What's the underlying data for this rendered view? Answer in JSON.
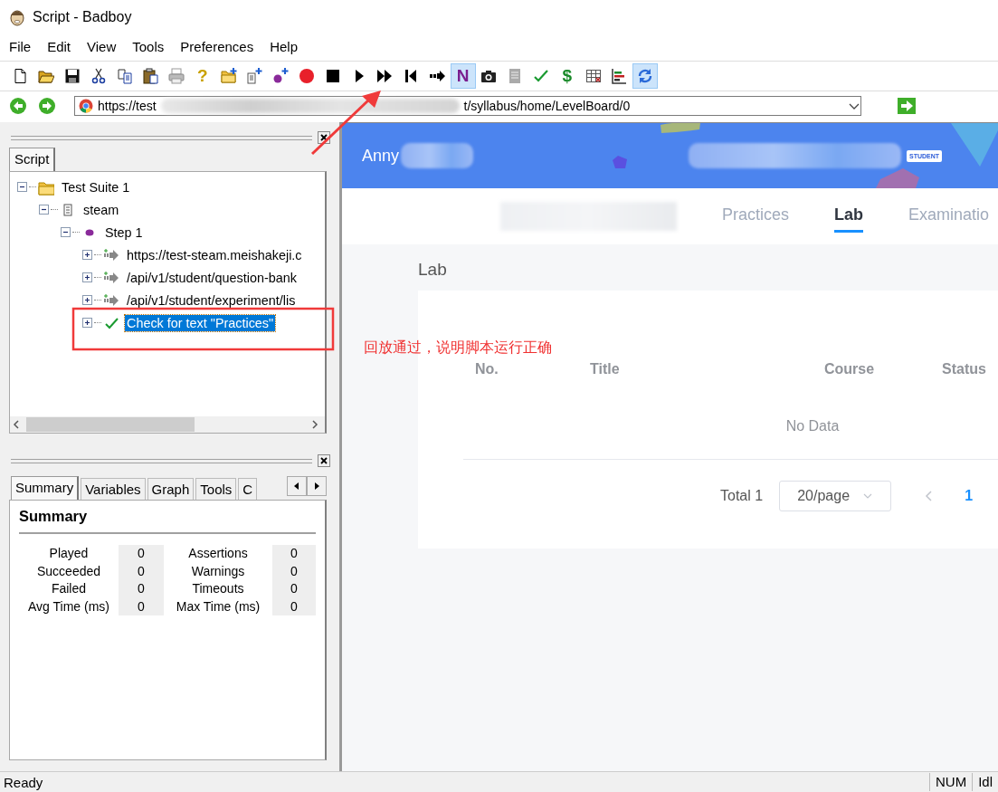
{
  "window": {
    "title": "Script - Badboy"
  },
  "menu": [
    "File",
    "Edit",
    "View",
    "Tools",
    "Preferences",
    "Help"
  ],
  "toolbar": [
    {
      "kind": "new",
      "pressed": false
    },
    {
      "kind": "open",
      "pressed": false
    },
    {
      "kind": "save",
      "pressed": false
    },
    {
      "kind": "cut",
      "pressed": false
    },
    {
      "kind": "copy",
      "pressed": false
    },
    {
      "kind": "paste",
      "pressed": false
    },
    {
      "kind": "print",
      "pressed": false
    },
    {
      "kind": "glyph",
      "text": "?",
      "color": "#c9a100",
      "pressed": false
    },
    {
      "kind": "new_suite",
      "pressed": false
    },
    {
      "kind": "new_test",
      "pressed": false
    },
    {
      "kind": "new_step",
      "pressed": false
    },
    {
      "kind": "record",
      "pressed": false
    },
    {
      "kind": "stop",
      "pressed": false
    },
    {
      "kind": "play",
      "pressed": false
    },
    {
      "kind": "play_all",
      "pressed": false
    },
    {
      "kind": "rewind",
      "pressed": false
    },
    {
      "kind": "step",
      "pressed": false
    },
    {
      "kind": "glyph",
      "text": "N",
      "color": "#7a1f8f",
      "pressed": true
    },
    {
      "kind": "camera",
      "pressed": false
    },
    {
      "kind": "doc",
      "pressed": false
    },
    {
      "kind": "check",
      "pressed": false
    },
    {
      "kind": "glyph",
      "text": "$",
      "color": "#1a8a2a",
      "pressed": false
    },
    {
      "kind": "table",
      "pressed": false
    },
    {
      "kind": "chart",
      "pressed": false
    },
    {
      "kind": "refresh",
      "pressed": true
    }
  ],
  "address_bar": {
    "url_start": "https://test",
    "url_end": "t/syllabus/home/LevelBoard/0"
  },
  "script_pane": {
    "tabs": [
      {
        "label": "Script",
        "selected": true
      }
    ],
    "tree": [
      {
        "kind": "suite",
        "label": "Test Suite 1",
        "expanded": true,
        "selected": false,
        "children": [
          {
            "kind": "test",
            "label": "steam",
            "expanded": true,
            "selected": false,
            "children": [
              {
                "kind": "step",
                "label": "Step 1",
                "expanded": true,
                "selected": false,
                "children": [
                  {
                    "kind": "request",
                    "label": "https://test-steam.meishakeji.c",
                    "expanded": false,
                    "selected": false
                  },
                  {
                    "kind": "request",
                    "label": "/api/v1/student/question-bank",
                    "expanded": false,
                    "selected": false
                  },
                  {
                    "kind": "request",
                    "label": "/api/v1/student/experiment/lis",
                    "expanded": false,
                    "selected": false
                  },
                  {
                    "kind": "check",
                    "label": "Check for text \"Practices\"",
                    "expanded": false,
                    "selected": true
                  }
                ]
              }
            ]
          }
        ]
      }
    ]
  },
  "summary_pane": {
    "tabs": [
      {
        "label": "Summary",
        "selected": true
      },
      {
        "label": "Variables",
        "selected": false
      },
      {
        "label": "Graph",
        "selected": false
      },
      {
        "label": "Tools",
        "selected": false
      },
      {
        "label": "C",
        "selected": false
      }
    ],
    "heading": "Summary",
    "stats": [
      {
        "label": "Played",
        "value": "0",
        "label_2": "Assertions",
        "value_2": "0"
      },
      {
        "label": "Succeeded",
        "value": "0",
        "label_2": "Warnings",
        "value_2": "0"
      },
      {
        "label": "Failed",
        "value": "0",
        "label_2": "Timeouts",
        "value_2": "0"
      },
      {
        "label": "Avg Time (ms)",
        "value": "0",
        "label_2": "Max Time (ms)",
        "value_2": "0"
      }
    ]
  },
  "web_page": {
    "user": "Anny",
    "badge": "STUDENT",
    "nav_tabs": [
      {
        "kind": "redacted",
        "selected": false
      },
      {
        "kind": "text",
        "label": "Practices",
        "selected": false
      },
      {
        "kind": "text",
        "label": "Lab",
        "selected": true
      },
      {
        "kind": "text",
        "label": "Examinatio",
        "selected": false
      }
    ],
    "section_title": "Lab",
    "table": {
      "columns": [
        "No.",
        "Title",
        "Course",
        "Status"
      ],
      "empty_text": "No Data"
    },
    "pagination": {
      "total": "Total 1",
      "page_size": "20/page",
      "pages": [
        {
          "label": "1",
          "selected": true
        }
      ]
    }
  },
  "annotation": {
    "text": "回放通过，说明脚本运行正确"
  },
  "status_bar": {
    "message": "Ready",
    "panels": [
      "NUM",
      "Idl"
    ]
  }
}
